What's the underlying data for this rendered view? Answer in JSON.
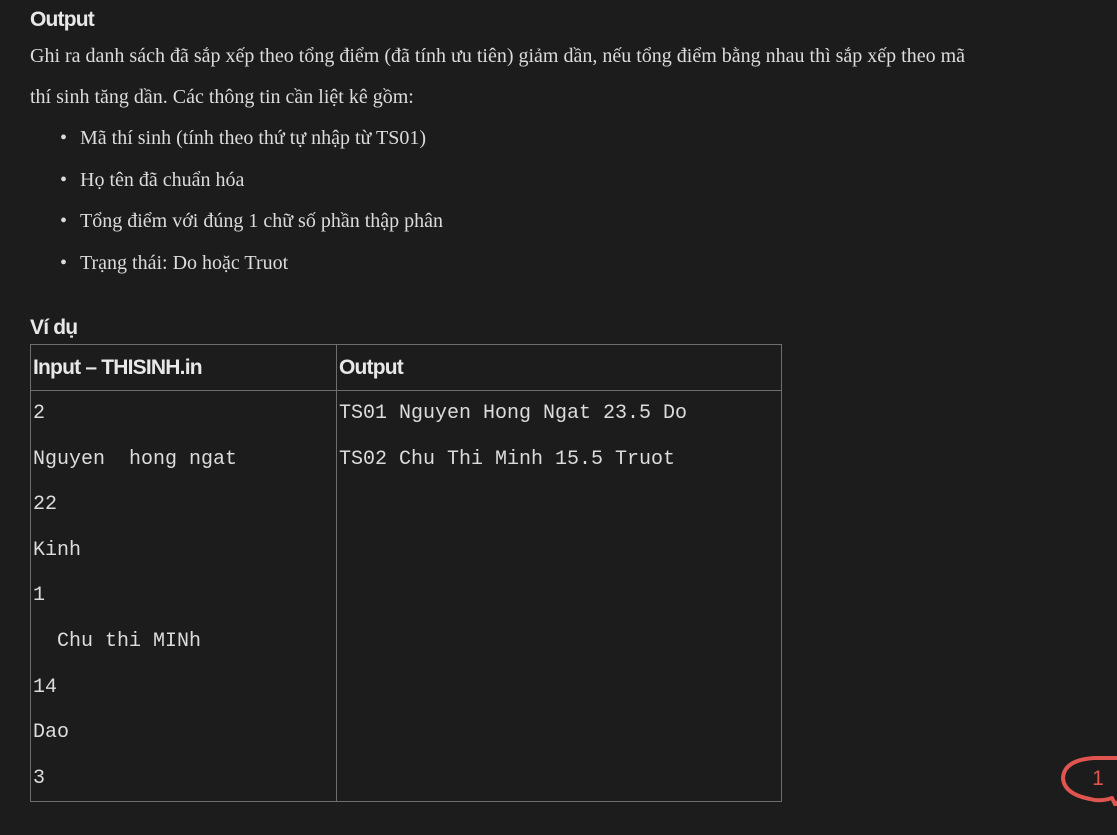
{
  "output_section": {
    "title": "Output",
    "description_line1": "Ghi ra danh sách đã sắp xếp theo tổng điểm (đã tính ưu tiên) giảm dần, nếu tổng điểm bằng nhau thì sắp xếp theo mã",
    "description_line2": "thí sinh tăng dần. Các thông tin cần liệt kê gồm:",
    "fields": [
      "Mã thí sinh (tính theo thứ tự nhập từ TS01)",
      "Họ tên đã chuẩn hóa",
      "Tổng điểm với đúng 1 chữ số phần thập phân",
      "Trạng thái: Do hoặc Truot"
    ]
  },
  "example_section": {
    "title": "Ví dụ",
    "input_header": "Input – THISINH.in",
    "output_header": "Output",
    "input_lines": [
      "2",
      "Nguyen  hong ngat",
      "22",
      "Kinh",
      "1",
      "  Chu thi MINh",
      "14",
      "Dao",
      "3"
    ],
    "output_lines": [
      "TS01 Nguyen Hong Ngat 23.5 Do",
      "TS02 Chu Thi Minh 15.5 Truot"
    ]
  },
  "notification_badge": {
    "count": "1",
    "icon": "speech-bubble-icon",
    "color": "#e0554f"
  }
}
